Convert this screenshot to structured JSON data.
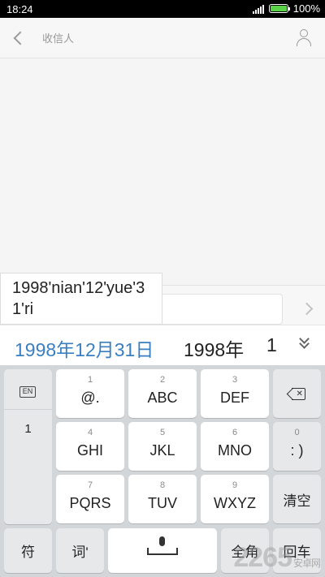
{
  "status_bar": {
    "time": "18:24",
    "battery_level": 1.0,
    "battery_text": "100%"
  },
  "header": {
    "recipient_placeholder": "收信人",
    "back_icon": "chevron-left-icon",
    "contact_icon": "person-icon"
  },
  "pinyin_composition": "1998'nian'12'yue'31'ri",
  "candidates": [
    "1998年12月31日",
    "1998年",
    "1"
  ],
  "keyboard": {
    "lang_label": "EN",
    "side_panel_item": "1",
    "row1": [
      {
        "hint": "1",
        "label": "@."
      },
      {
        "hint": "2",
        "label": "ABC"
      },
      {
        "hint": "3",
        "label": "DEF"
      }
    ],
    "row2": [
      {
        "hint": "4",
        "label": "GHI"
      },
      {
        "hint": "5",
        "label": "JKL"
      },
      {
        "hint": "6",
        "label": "MNO"
      }
    ],
    "row3": [
      {
        "hint": "7",
        "label": "PQRS"
      },
      {
        "hint": "8",
        "label": "TUV"
      },
      {
        "hint": "9",
        "label": "WXYZ"
      }
    ],
    "zero_key": {
      "hint": "0",
      "label": ": )"
    },
    "clear_key": "清空",
    "bottom_row": {
      "symbol": "符",
      "word": "词'",
      "fullwidth": "全角",
      "enter": "回车"
    }
  },
  "watermark": {
    "text": "2265",
    "suffix": "安卓网"
  },
  "colors": {
    "candidate_selected": "#3a7fc1",
    "battery": "#59d248"
  }
}
